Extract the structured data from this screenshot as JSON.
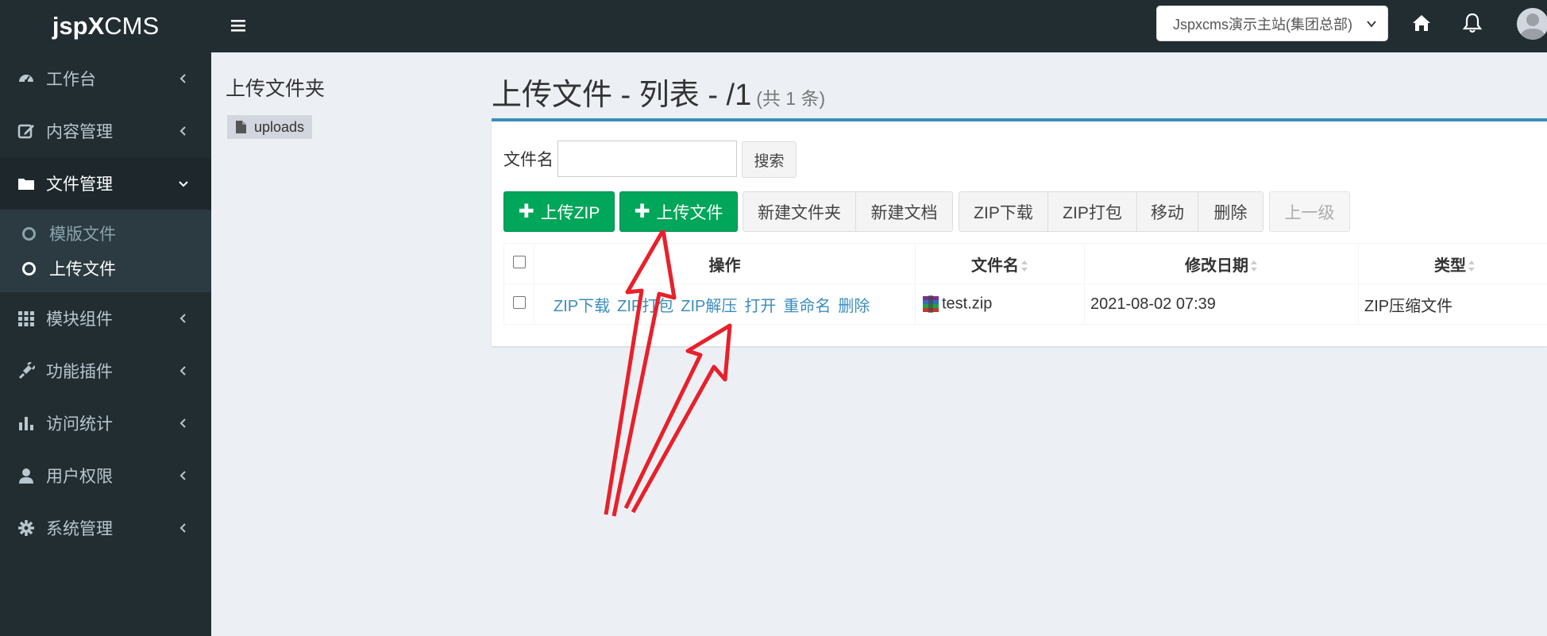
{
  "app": {
    "logo_bold": "jspX",
    "logo_thin": "CMS"
  },
  "sidebar": {
    "items": [
      {
        "label": "工作台",
        "icon": "dashboard-icon"
      },
      {
        "label": "内容管理",
        "icon": "edit-icon"
      },
      {
        "label": "文件管理",
        "icon": "folder-icon",
        "expanded": true
      },
      {
        "label": "模块组件",
        "icon": "grid-icon"
      },
      {
        "label": "功能插件",
        "icon": "plug-icon"
      },
      {
        "label": "访问统计",
        "icon": "bar-chart-icon"
      },
      {
        "label": "用户权限",
        "icon": "user-icon"
      },
      {
        "label": "系统管理",
        "icon": "gear-icon"
      }
    ],
    "submenu": [
      {
        "label": "模版文件",
        "active": false
      },
      {
        "label": "上传文件",
        "active": true
      }
    ]
  },
  "header": {
    "site_select": "Jspxcms演示主站(集团总部)"
  },
  "tree": {
    "title": "上传文件夹",
    "node": "uploads"
  },
  "main": {
    "title": "上传文件 - 列表 - /1",
    "count": "(共 1 条)",
    "search_label": "文件名",
    "search_value": "",
    "search_button": "搜索",
    "buttons": {
      "upload_zip": "上传ZIP",
      "upload_file": "上传文件",
      "new_folder": "新建文件夹",
      "new_doc": "新建文档",
      "zip_download": "ZIP下载",
      "zip_pack": "ZIP打包",
      "move": "移动",
      "delete": "删除",
      "up_level": "上一级"
    },
    "table": {
      "headers": [
        "操作",
        "文件名",
        "修改日期",
        "类型"
      ],
      "rows": [
        {
          "actions": [
            "ZIP下载",
            "ZIP打包",
            "ZIP解压",
            "打开",
            "重命名",
            "删除"
          ],
          "filename": "test.zip",
          "modified": "2021-08-02 07:39",
          "type": "ZIP压缩文件"
        }
      ]
    }
  },
  "colors": {
    "sidebar_bg": "#222d32",
    "accent_blue": "#3c8dbc",
    "btn_green": "#00a65a",
    "annotation_red": "#e8202a"
  }
}
